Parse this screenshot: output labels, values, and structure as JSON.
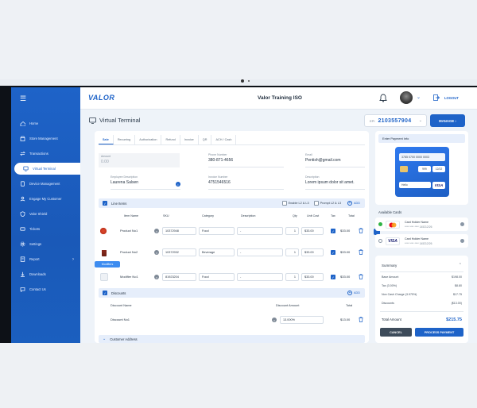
{
  "app": {
    "logo": "VALOR",
    "title": "Valor Training ISO",
    "logout": "LOGOUT"
  },
  "sidebar": {
    "items": [
      {
        "label": "Home",
        "icon": "home-icon"
      },
      {
        "label": "Store Management",
        "icon": "store-icon"
      },
      {
        "label": "Transactions",
        "icon": "transactions-icon"
      },
      {
        "label": "Virtual Terminal",
        "icon": "terminal-icon",
        "active": true
      },
      {
        "label": "Device Management",
        "icon": "device-icon"
      },
      {
        "label": "Engage My Customer",
        "icon": "engage-icon"
      },
      {
        "label": "Valor Shield",
        "icon": "shield-icon"
      },
      {
        "label": "Tickets",
        "icon": "ticket-icon"
      },
      {
        "label": "Settings",
        "icon": "gear-icon"
      },
      {
        "label": "Report",
        "icon": "report-icon",
        "chevron": true
      },
      {
        "label": "Downloads",
        "icon": "download-icon"
      },
      {
        "label": "Contact Us",
        "icon": "contact-icon"
      }
    ]
  },
  "page": {
    "title": "Virtual Terminal",
    "epi_label": "EPI",
    "epi_value": "2103557904",
    "manage": "MANAGE"
  },
  "tabs": [
    "Sale",
    "Recurring",
    "Authorization",
    "Refund",
    "Invoice",
    "QR",
    "ACH / Cash"
  ],
  "form": {
    "amount": {
      "label": "Amount",
      "value": "0.00"
    },
    "phone": {
      "label": "Phone Number",
      "value": "380-871-4656"
    },
    "email": {
      "label": "Email",
      "value": "Pentish@gmail.com"
    },
    "employee": {
      "label": "Employee Description",
      "value": "Laurena Salsen"
    },
    "invoice": {
      "label": "Invoice Number",
      "value": "4751546516"
    },
    "description": {
      "label": "Description",
      "value": "Lorem ipsum dolor sit amet."
    }
  },
  "line_items": {
    "title": "Line Items",
    "enable": "Enable L2 & L3",
    "prompt": "Prompt L2 & L3",
    "add": "ADD",
    "columns": [
      "Item Name",
      "SKU",
      "Category",
      "Description",
      "Qty",
      "Unit Cost",
      "Tax",
      "Total"
    ],
    "rows": [
      {
        "name": "Product No1",
        "sku": "10372948",
        "category": "Food",
        "description": "-",
        "qty": "1",
        "unit": "$33.00",
        "total": "$33.00"
      },
      {
        "name": "Product No2",
        "sku": "10372932",
        "category": "Beverage",
        "description": "-",
        "qty": "1",
        "unit": "$33.00",
        "total": "$33.00"
      },
      {
        "name": "Modifier No1",
        "sku": "81923204",
        "category": "Food",
        "description": "-",
        "qty": "1",
        "unit": "$33.00",
        "total": "$33.00"
      }
    ],
    "modifiers": "Modifiers"
  },
  "discounts": {
    "title": "Discounts",
    "add": "ADD",
    "columns": [
      "Discount Name",
      "Discount Amount",
      "Total"
    ],
    "row": {
      "name": "Discount No1",
      "amount": "13.000%",
      "total": "$13.00"
    }
  },
  "customer": {
    "title": "Customer Address"
  },
  "payment": {
    "title": "Enter Payment Info",
    "card_number": "3785 0700 0000 0003",
    "cvv": "999",
    "exp": "12/22",
    "name": "Hello",
    "brand": "VISA"
  },
  "available": {
    "title": "Available Cards",
    "cards": [
      {
        "holder": "Card Holder Name",
        "digits": "**** **** **** 1452",
        "exp": "12/26",
        "brand": "mastercard"
      },
      {
        "holder": "Card Holder Name",
        "digits": "**** **** **** 1452",
        "exp": "12/26",
        "brand": "VISA"
      }
    ]
  },
  "summary": {
    "title": "Summary",
    "rows": [
      {
        "label": "Base Amount",
        "value": "$198.00"
      },
      {
        "label": "Tax (3.00%)",
        "value": "$8.80"
      },
      {
        "label": "Non Cash Charge (3.975%)",
        "value": "$17.75"
      },
      {
        "label": "Discounts",
        "value": "($13.00)"
      }
    ],
    "total_label": "Total Amount",
    "total_value": "$215.75",
    "cancel": "CANCEL",
    "process": "PROCESS PAYMENT"
  },
  "colors": {
    "primary": "#1e63c8",
    "sidebar": "#1a59b8"
  }
}
